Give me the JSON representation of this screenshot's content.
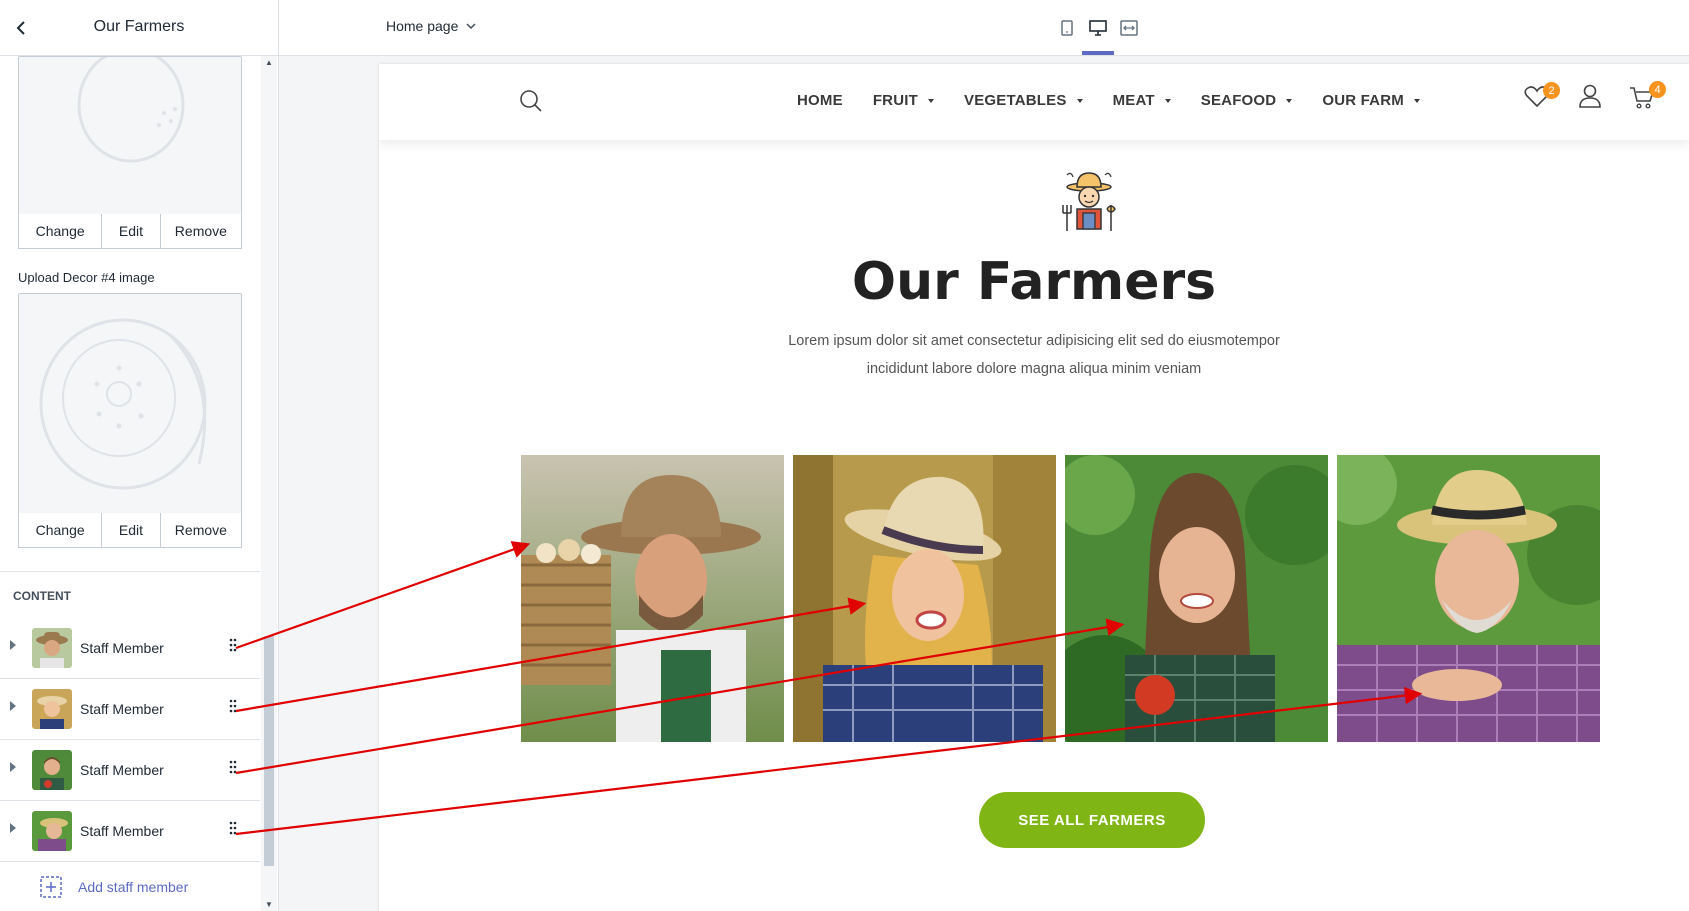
{
  "sidebar": {
    "title": "Our Farmers",
    "image_actions": {
      "change": "Change",
      "edit": "Edit",
      "remove": "Remove"
    },
    "upload_label": "Upload Decor #4 image",
    "content_heading": "CONTENT",
    "staff": [
      {
        "label": "Staff Member"
      },
      {
        "label": "Staff Member"
      },
      {
        "label": "Staff Member"
      },
      {
        "label": "Staff Member"
      }
    ],
    "add_label": "Add staff member"
  },
  "topbar": {
    "page_select": "Home page",
    "devices": [
      "mobile-icon",
      "desktop-icon",
      "fullwidth-icon"
    ],
    "active_device": "desktop"
  },
  "store": {
    "nav": [
      {
        "label": "HOME",
        "dropdown": false
      },
      {
        "label": "FRUIT",
        "dropdown": true
      },
      {
        "label": "VEGETABLES",
        "dropdown": true
      },
      {
        "label": "MEAT",
        "dropdown": true
      },
      {
        "label": "SEAFOOD",
        "dropdown": true
      },
      {
        "label": "OUR FARM",
        "dropdown": true
      }
    ],
    "wishlist_count": "2",
    "cart_count": "4"
  },
  "section": {
    "title": "Our Farmers",
    "subtitle": "Lorem ipsum dolor sit amet consectetur adipisicing elit sed do eiusmotempor incididunt labore dolore magna aliqua minim veniam",
    "button": "SEE ALL FARMERS"
  },
  "colors": {
    "accent": "#5c6ac4",
    "cta_green": "#7fb515",
    "badge_orange": "#f7931e",
    "arrow_red": "#e00000"
  }
}
